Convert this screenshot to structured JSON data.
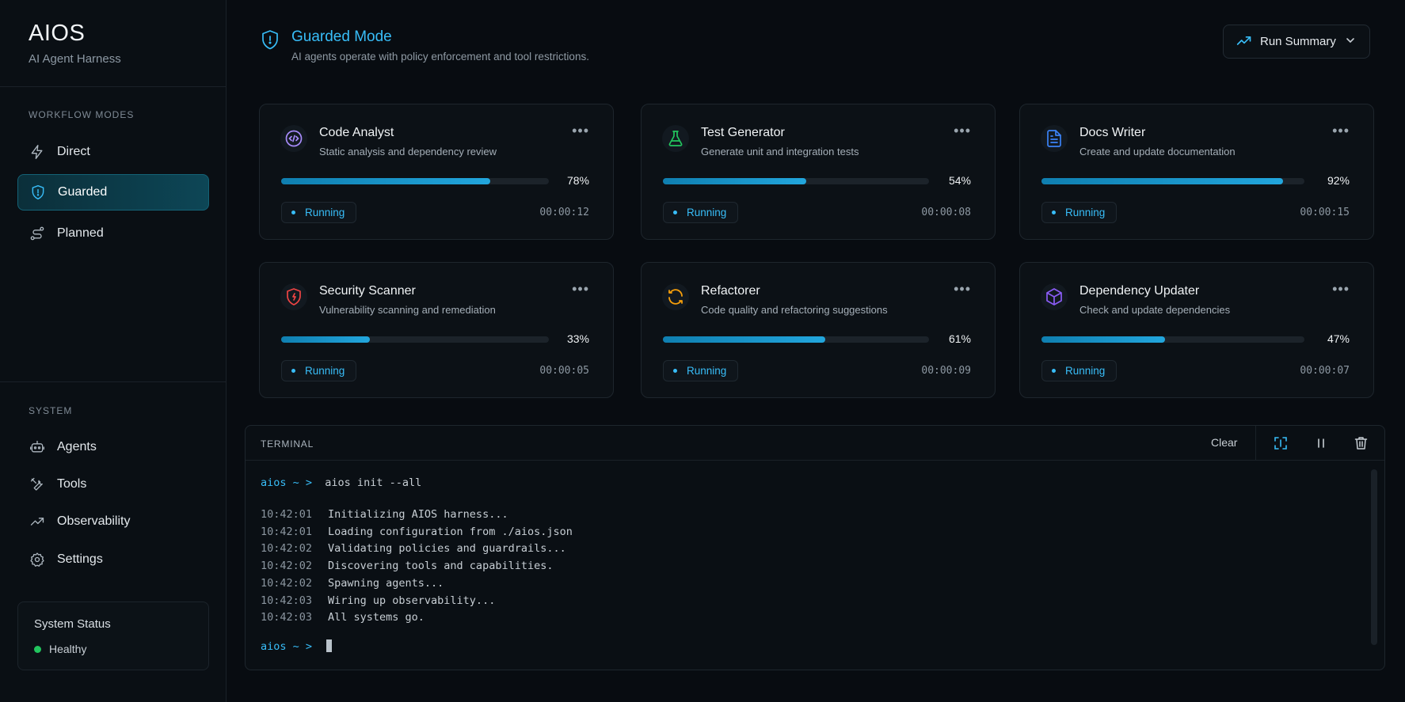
{
  "brand": {
    "title": "AIOS",
    "subtitle": "AI Agent Harness"
  },
  "sidebar": {
    "workflow_heading": "WORKFLOW MODES",
    "workflow_items": [
      {
        "label": "Direct",
        "icon": "lightning-icon",
        "active": false
      },
      {
        "label": "Guarded",
        "icon": "shield-icon",
        "active": true
      },
      {
        "label": "Planned",
        "icon": "route-icon",
        "active": false
      }
    ],
    "system_heading": "SYSTEM",
    "system_items": [
      {
        "label": "Agents",
        "icon": "robot-icon"
      },
      {
        "label": "Tools",
        "icon": "tools-icon"
      },
      {
        "label": "Observability",
        "icon": "trend-icon"
      },
      {
        "label": "Settings",
        "icon": "gear-icon"
      }
    ],
    "status": {
      "title": "System Status",
      "value": "Healthy",
      "color": "#22c55e"
    }
  },
  "header": {
    "title": "Guarded Mode",
    "description": "AI agents operate with policy enforcement and tool restrictions.",
    "run_summary_label": "Run Summary"
  },
  "agents": [
    {
      "name": "Code Analyst",
      "description": "Static analysis and dependency review",
      "progress": 78,
      "progress_label": "78%",
      "status": "Running",
      "elapsed": "00:00:12",
      "icon": "code-icon",
      "icon_color": "#a78bfa"
    },
    {
      "name": "Test Generator",
      "description": "Generate unit and integration tests",
      "progress": 54,
      "progress_label": "54%",
      "status": "Running",
      "elapsed": "00:00:08",
      "icon": "flask-icon",
      "icon_color": "#22c55e"
    },
    {
      "name": "Docs Writer",
      "description": "Create and update documentation",
      "progress": 92,
      "progress_label": "92%",
      "status": "Running",
      "elapsed": "00:00:15",
      "icon": "document-icon",
      "icon_color": "#3b82f6"
    },
    {
      "name": "Security Scanner",
      "description": "Vulnerability scanning and remediation",
      "progress": 33,
      "progress_label": "33%",
      "status": "Running",
      "elapsed": "00:00:05",
      "icon": "shield-alert-icon",
      "icon_color": "#ef4444"
    },
    {
      "name": "Refactorer",
      "description": "Code quality and refactoring suggestions",
      "progress": 61,
      "progress_label": "61%",
      "status": "Running",
      "elapsed": "00:00:09",
      "icon": "refresh-icon",
      "icon_color": "#f59e0b"
    },
    {
      "name": "Dependency Updater",
      "description": "Check and update dependencies",
      "progress": 47,
      "progress_label": "47%",
      "status": "Running",
      "elapsed": "00:00:07",
      "icon": "package-icon",
      "icon_color": "#8b5cf6"
    }
  ],
  "terminal": {
    "label": "TERMINAL",
    "clear_label": "Clear",
    "prompt": "aios ~ >",
    "command": "aios init --all",
    "logs": [
      {
        "time": "10:42:01",
        "text": "Initializing AIOS harness..."
      },
      {
        "time": "10:42:01",
        "text": "Loading configuration from ./aios.json"
      },
      {
        "time": "10:42:02",
        "text": "Validating policies and guardrails..."
      },
      {
        "time": "10:42:02",
        "text": "Discovering tools and capabilities."
      },
      {
        "time": "10:42:02",
        "text": "Spawning agents..."
      },
      {
        "time": "10:42:03",
        "text": "Wiring up observability..."
      },
      {
        "time": "10:42:03",
        "text": "All systems go."
      }
    ]
  },
  "colors": {
    "accent": "#38bdf8",
    "background": "#080c11"
  }
}
